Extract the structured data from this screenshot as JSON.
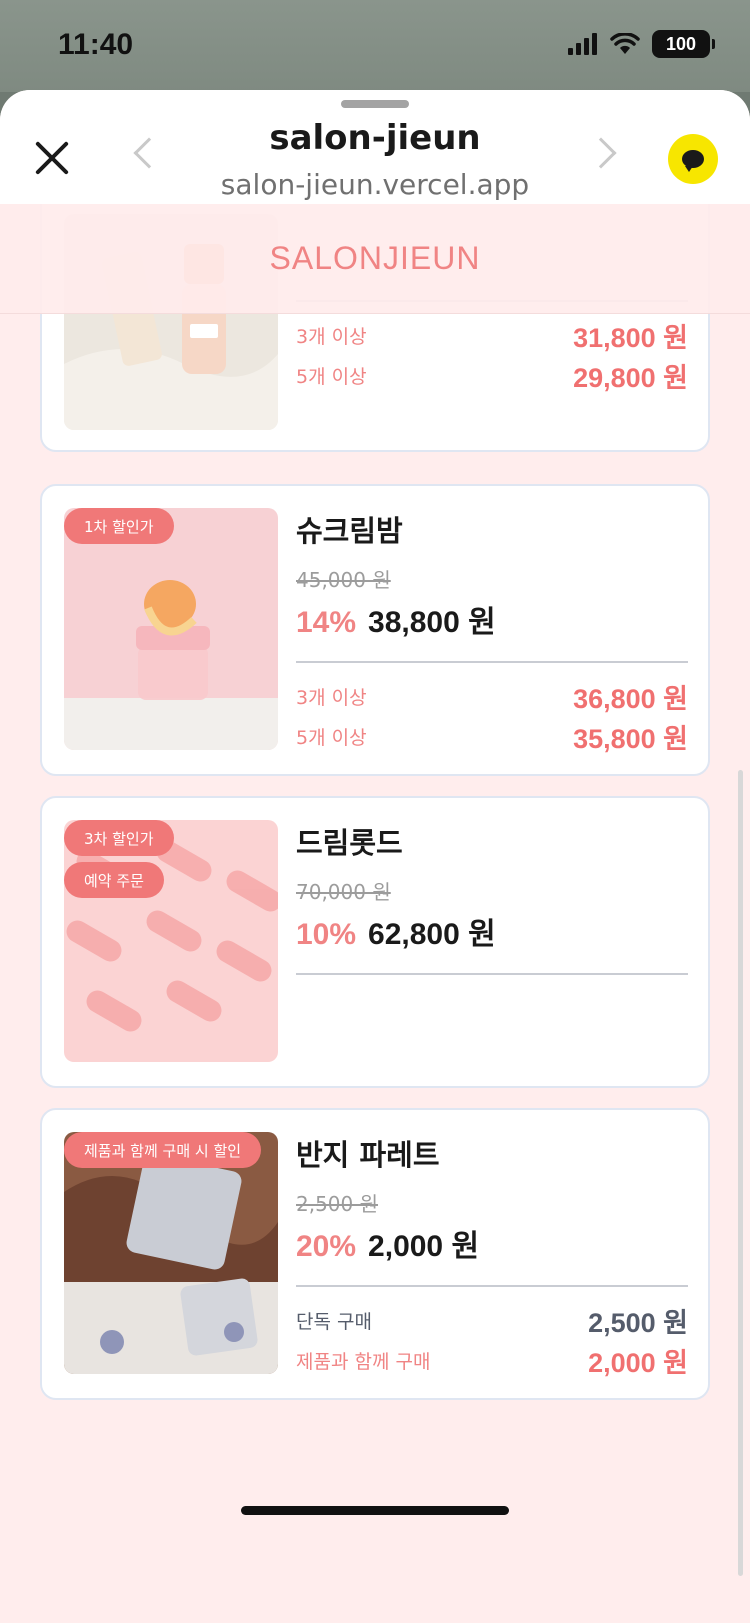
{
  "status_bar": {
    "time": "11:40",
    "battery": "100"
  },
  "browser": {
    "title": "salon-jieun",
    "url": "salon-jieun.vercel.app"
  },
  "brand": {
    "name": "SALONJIEUN"
  },
  "products": [
    {
      "name": "",
      "tiers": [
        {
          "label": "3개 이상",
          "price": "31,800 원"
        },
        {
          "label": "5개 이상",
          "price": "29,800 원"
        }
      ]
    },
    {
      "name": "슈크림밤",
      "badges": [
        "1차 할인가"
      ],
      "original_price": "45,000 원",
      "discount": "14%",
      "sale_price": "38,800 원",
      "tiers": [
        {
          "label": "3개 이상",
          "price": "36,800 원"
        },
        {
          "label": "5개 이상",
          "price": "35,800 원"
        }
      ]
    },
    {
      "name": "드림롯드",
      "badges": [
        "3차 할인가",
        "예약 주문"
      ],
      "original_price": "70,000 원",
      "discount": "10%",
      "sale_price": "62,800 원",
      "tiers": []
    },
    {
      "name": "반지 파레트",
      "badges": [
        "제품과 함께 구매 시 할인"
      ],
      "original_price": "2,500 원",
      "discount": "20%",
      "sale_price": "2,000 원",
      "tiers": [
        {
          "label": "단독 구매",
          "price": "2,500 원"
        },
        {
          "label": "제품과 함께 구매",
          "price": "2,000 원"
        }
      ]
    }
  ]
}
